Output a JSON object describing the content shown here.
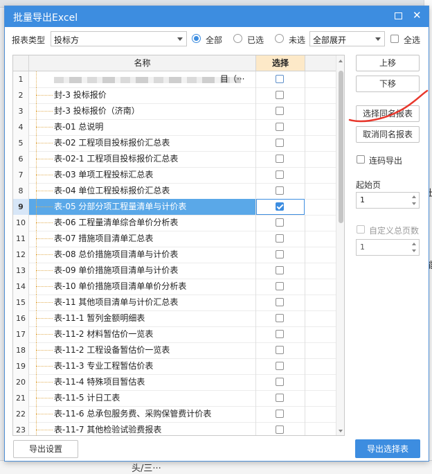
{
  "background": {
    "right_glyphs": [
      "出",
      "能"
    ],
    "bottom_text": "头/三···"
  },
  "dialog": {
    "title": "批量导出Excel",
    "max_icon": "maximize-icon",
    "close_icon": "close-icon",
    "close_glyph": "✕"
  },
  "toolbar": {
    "report_type_label": "报表类型",
    "report_type_value": "投标方",
    "radio_all": "全部",
    "radio_selected": "已选",
    "radio_unselected": "未选",
    "expand_value": "全部展开",
    "select_all_label": "全选"
  },
  "table": {
    "col_name": "名称",
    "col_select": "选择",
    "first_row_suffix": "目（···",
    "rows": [
      {
        "num": "1",
        "name": "",
        "checked": false
      },
      {
        "num": "2",
        "name": "封-3 投标报价",
        "checked": false
      },
      {
        "num": "3",
        "name": "封-3 投标报价（济南）",
        "checked": false
      },
      {
        "num": "4",
        "name": "表-01 总说明",
        "checked": false
      },
      {
        "num": "5",
        "name": "表-02 工程项目投标报价汇总表",
        "checked": false
      },
      {
        "num": "6",
        "name": "表-02-1 工程项目投标报价汇总表",
        "checked": false
      },
      {
        "num": "7",
        "name": "表-03 单项工程投标汇总表",
        "checked": false
      },
      {
        "num": "8",
        "name": "表-04 单位工程投标报价汇总表",
        "checked": false
      },
      {
        "num": "9",
        "name": "表-05 分部分项工程量清单与计价表",
        "checked": true
      },
      {
        "num": "10",
        "name": "表-06 工程量清单综合单价分析表",
        "checked": false
      },
      {
        "num": "11",
        "name": "表-07 措施项目清单汇总表",
        "checked": false
      },
      {
        "num": "12",
        "name": "表-08 总价措施项目清单与计价表",
        "checked": false
      },
      {
        "num": "13",
        "name": "表-09 单价措施项目清单与计价表",
        "checked": false
      },
      {
        "num": "14",
        "name": "表-10 单价措施项目清单单价分析表",
        "checked": false
      },
      {
        "num": "15",
        "name": "表-11 其他项目清单与计价汇总表",
        "checked": false
      },
      {
        "num": "16",
        "name": "表-11-1 暂列金额明细表",
        "checked": false
      },
      {
        "num": "17",
        "name": "表-11-2 材料暂估价一览表",
        "checked": false
      },
      {
        "num": "18",
        "name": "表-11-2 工程设备暂估价一览表",
        "checked": false
      },
      {
        "num": "19",
        "name": "表-11-3 专业工程暂估价表",
        "checked": false
      },
      {
        "num": "20",
        "name": "表-11-4 特殊项目暂估表",
        "checked": false
      },
      {
        "num": "21",
        "name": "表-11-5 计日工表",
        "checked": false
      },
      {
        "num": "22",
        "name": "表-11-6 总承包服务费、采购保管费计价表",
        "checked": false
      },
      {
        "num": "23",
        "name": "表-11-7 其他检验试验费报表",
        "checked": false
      }
    ]
  },
  "side": {
    "move_up": "上移",
    "move_down": "下移",
    "select_same": "选择同名报表",
    "cancel_same": "取消同名报表",
    "continuous_export": "连码导出",
    "start_page_label": "起始页",
    "start_page_value": "1",
    "custom_total_label": "自定义总页数",
    "custom_total_value": "1"
  },
  "footer": {
    "export_settings": "导出设置",
    "export_selected": "导出选择表"
  },
  "colors": {
    "accent": "#3d8de0",
    "highlight_row": "#5aa8e8",
    "select_header": "#fde9c8",
    "annotation": "#e8372c"
  }
}
